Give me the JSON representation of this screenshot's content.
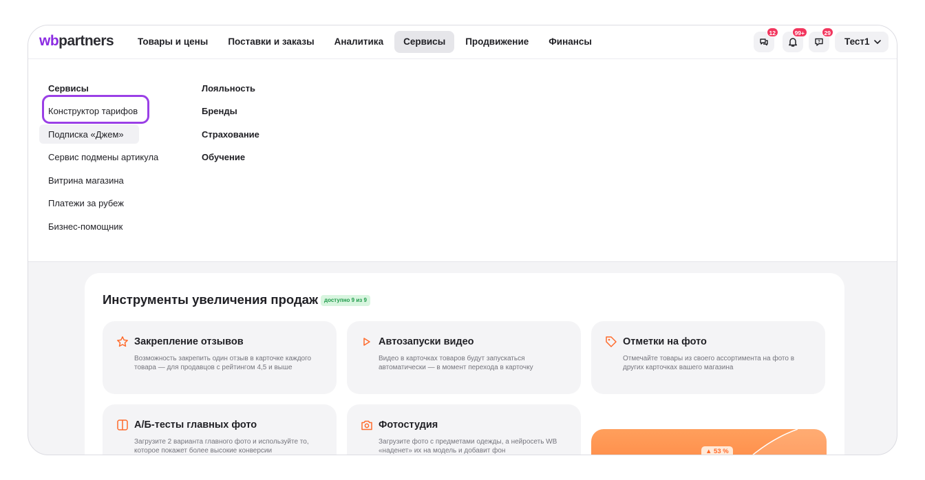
{
  "brand": {
    "logo_prefix": "wb",
    "logo_suffix": "partners",
    "accent": "#8b2be2"
  },
  "nav": {
    "items": [
      {
        "label": "Товары и цены"
      },
      {
        "label": "Поставки и заказы"
      },
      {
        "label": "Аналитика"
      },
      {
        "label": "Сервисы",
        "active": true
      },
      {
        "label": "Продвижение"
      },
      {
        "label": "Финансы"
      }
    ]
  },
  "header": {
    "chat_badge": "12",
    "notifications_badge": "99+",
    "support_badge": "29",
    "user_label": "Тест1",
    "badge_color": "#f2365e"
  },
  "menu": {
    "col1": [
      "Сервисы",
      "Конструктор тарифов",
      "Подписка «Джем»",
      "Сервис подмены артикула",
      "Витрина магазина",
      "Платежи за рубеж",
      "Бизнес-помощник"
    ],
    "col2": [
      "Лояльность",
      "Бренды",
      "Страхование",
      "Обучение"
    ],
    "highlight_color": "#9a3fe6"
  },
  "tools": {
    "title": "Инструменты увеличения продаж",
    "availability": "доступно 9 из 9",
    "cards": [
      {
        "icon": "star-icon",
        "title": "Закрепление отзывов",
        "desc": "Возможность закрепить один отзыв в карточке каждого товара — для продавцов с рейтингом 4,5 и выше"
      },
      {
        "icon": "play-icon",
        "title": "Автозапуски видео",
        "desc": "Видео в карточках товаров будут запускаться автоматически — в момент перехода в карточку"
      },
      {
        "icon": "tag-icon",
        "title": "Отметки на фото",
        "desc": "Отмечайте товары из своего ассортимента на фото в других карточках вашего магазина"
      },
      {
        "icon": "ab-test-icon",
        "title": "А/Б-тесты главных фото",
        "desc": "Загрузите 2 варианта главного фото и используйте то, которое покажет более высокие конверсии"
      },
      {
        "icon": "camera-icon",
        "title": "Фотостудия",
        "desc": "Загрузите фото с предметами одежды, а нейросеть WB «наденет» их на модель и добавит фон"
      }
    ],
    "promo_pill": "▲ 53 %",
    "icon_color": "#ff6a2a"
  }
}
